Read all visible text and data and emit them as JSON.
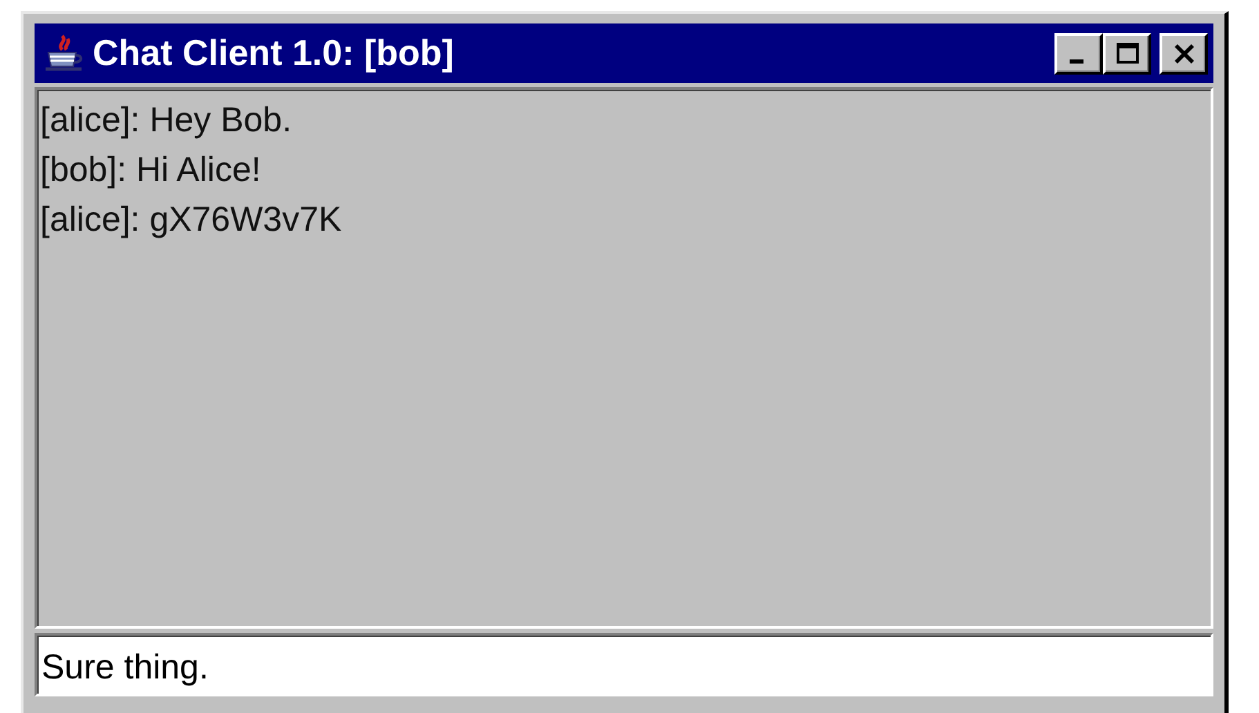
{
  "window": {
    "title": "Chat Client 1.0: [bob]"
  },
  "messages": [
    "[alice]: Hey Bob.",
    "[bob]: Hi Alice!",
    "[alice]: gX76W3v7K"
  ],
  "input": {
    "value": "Sure thing."
  }
}
